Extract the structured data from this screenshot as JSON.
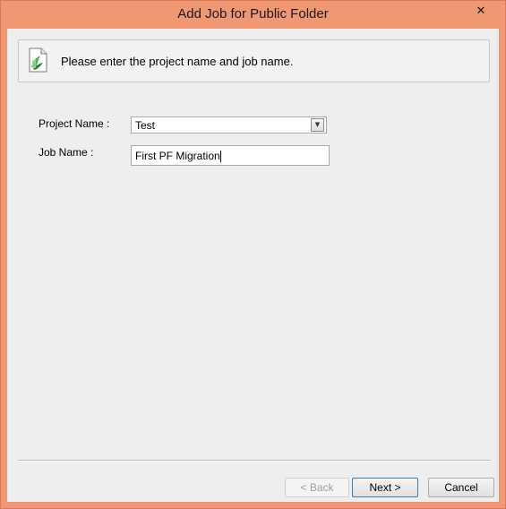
{
  "window": {
    "title": "Add Job for Public Folder",
    "close_glyph": "✕"
  },
  "header": {
    "instruction": "Please enter the project name and job name.",
    "icon": "document-green-icon"
  },
  "form": {
    "project_name_label": "Project Name :",
    "project_name_value": "Test",
    "job_name_label": "Job Name :",
    "job_name_value": "First PF Migration"
  },
  "buttons": {
    "back_label": "< Back",
    "next_label": "Next >",
    "cancel_label": "Cancel"
  },
  "colors": {
    "frame_accent": "#f09873",
    "client_background": "#eeeeee"
  }
}
